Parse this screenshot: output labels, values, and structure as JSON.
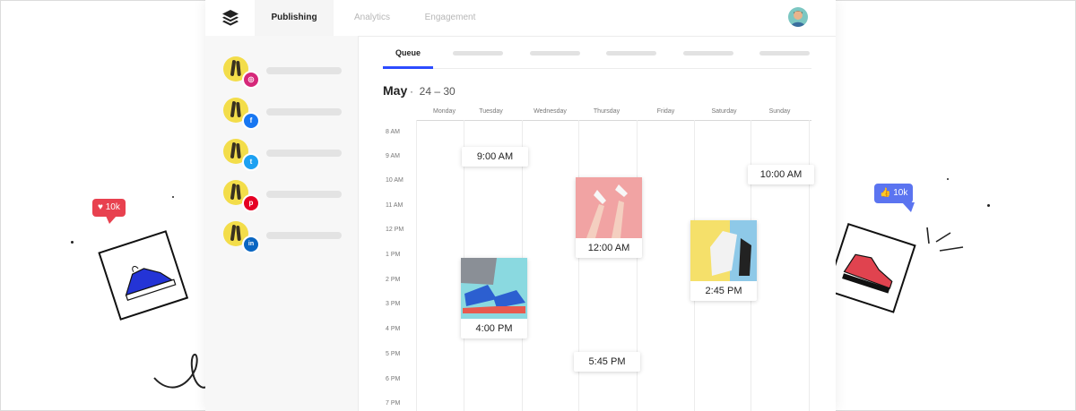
{
  "nav": {
    "tabs": [
      {
        "label": "Publishing",
        "active": true
      },
      {
        "label": "Analytics",
        "active": false
      },
      {
        "label": "Engagement",
        "active": false
      }
    ]
  },
  "sidebar": {
    "accounts": [
      {
        "network": "instagram-icon",
        "glyph": "◎",
        "color": "#d6287a"
      },
      {
        "network": "facebook-icon",
        "glyph": "f",
        "color": "#1877f2"
      },
      {
        "network": "twitter-icon",
        "glyph": "t",
        "color": "#1da1f2"
      },
      {
        "network": "pinterest-icon",
        "glyph": "p",
        "color": "#e60023"
      },
      {
        "network": "linkedin-icon",
        "glyph": "in",
        "color": "#0a66c2"
      }
    ]
  },
  "queue": {
    "tab_label": "Queue",
    "month": "May",
    "separator": "·",
    "range": "24 – 30"
  },
  "calendar": {
    "days": [
      "Monday",
      "Tuesday",
      "Wednesday",
      "Thursday",
      "Friday",
      "Saturday",
      "Sunday"
    ],
    "times": [
      "8 AM",
      "9 AM",
      "10 AM",
      "11 AM",
      "12 PM",
      "1 PM",
      "2 PM",
      "3 PM",
      "4 PM",
      "5 PM",
      "6 PM",
      "7 PM"
    ],
    "posts": [
      {
        "time": "9:00 AM",
        "day": "Tuesday"
      },
      {
        "time": "10:00 AM",
        "day": "Sunday"
      },
      {
        "time": "12:00 AM",
        "day": "Thursday"
      },
      {
        "time": "2:45 PM",
        "day": "Saturday"
      },
      {
        "time": "4:00 PM",
        "day": "Tuesday"
      },
      {
        "time": "5:45 PM",
        "day": "Thursday"
      }
    ]
  },
  "badges": {
    "likes": "10k",
    "thumbs": "10k"
  },
  "colors": {
    "accent": "#2c4bff",
    "like_badge": "#e8414f",
    "thumb_badge": "#5b74f0"
  }
}
